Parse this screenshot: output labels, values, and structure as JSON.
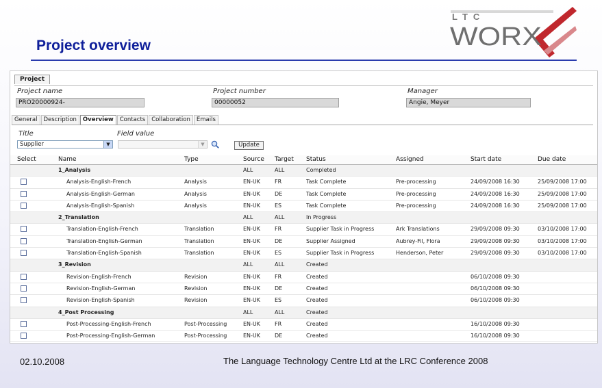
{
  "slide": {
    "title": "Project overview",
    "logo_small": "LTC",
    "logo_large": "WORX",
    "footer_date": "02.10.2008",
    "footer_text": "The Language Technology Centre Ltd at the LRC Conference 2008"
  },
  "colors": {
    "title": "#0f1f9a",
    "accent_x": "#c0272d",
    "logo_gray": "#6f6f6f"
  },
  "project": {
    "group_label": "Project",
    "name_label": "Project name",
    "name_value": "PRO20000924-",
    "number_label": "Project number",
    "number_value": "00000052",
    "manager_label": "Manager",
    "manager_value": "Angie, Meyer"
  },
  "tabs": [
    "General",
    "Description",
    "Overview",
    "Contacts",
    "Collaboration",
    "Emails"
  ],
  "active_tab": "Overview",
  "filter": {
    "title_label": "Title",
    "field_value_label": "Field value",
    "title_selected": "Supplier",
    "field_value": "",
    "search_icon": "search-icon",
    "update_label": "Update"
  },
  "grid": {
    "columns": [
      "Select",
      "Name",
      "Type",
      "Source",
      "Target",
      "Status",
      "Assigned",
      "Start date",
      "Due date"
    ],
    "rows": [
      {
        "group": true,
        "name": "1_Analysis",
        "type": "",
        "source": "ALL",
        "target": "ALL",
        "status": "Completed",
        "assigned": "",
        "start": "",
        "due": ""
      },
      {
        "group": false,
        "name": "Analysis-English-French",
        "type": "Analysis",
        "source": "EN-UK",
        "target": "FR",
        "status": "Task Complete",
        "assigned": "Pre-processing",
        "start": "24/09/2008 16:30",
        "due": "25/09/2008 17:00"
      },
      {
        "group": false,
        "name": "Analysis-English-German",
        "type": "Analysis",
        "source": "EN-UK",
        "target": "DE",
        "status": "Task Complete",
        "assigned": "Pre-processing",
        "start": "24/09/2008 16:30",
        "due": "25/09/2008 17:00"
      },
      {
        "group": false,
        "name": "Analysis-English-Spanish",
        "type": "Analysis",
        "source": "EN-UK",
        "target": "ES",
        "status": "Task Complete",
        "assigned": "Pre-processing",
        "start": "24/09/2008 16:30",
        "due": "25/09/2008 17:00"
      },
      {
        "group": true,
        "name": "2_Translation",
        "type": "",
        "source": "ALL",
        "target": "ALL",
        "status": "In Progress",
        "assigned": "",
        "start": "",
        "due": ""
      },
      {
        "group": false,
        "name": "Translation-English-French",
        "type": "Translation",
        "source": "EN-UK",
        "target": "FR",
        "status": "Supplier Task in Progress",
        "assigned": "Ark Translations",
        "start": "29/09/2008 09:30",
        "due": "03/10/2008 17:00"
      },
      {
        "group": false,
        "name": "Translation-English-German",
        "type": "Translation",
        "source": "EN-UK",
        "target": "DE",
        "status": "Supplier Assigned",
        "assigned": "Aubrey-Fil, Flora",
        "start": "29/09/2008 09:30",
        "due": "03/10/2008 17:00"
      },
      {
        "group": false,
        "name": "Translation-English-Spanish",
        "type": "Translation",
        "source": "EN-UK",
        "target": "ES",
        "status": "Supplier Task in Progress",
        "assigned": "Henderson, Peter",
        "start": "29/09/2008 09:30",
        "due": "03/10/2008 17:00"
      },
      {
        "group": true,
        "name": "3_Revision",
        "type": "",
        "source": "ALL",
        "target": "ALL",
        "status": "Created",
        "assigned": "",
        "start": "",
        "due": ""
      },
      {
        "group": false,
        "name": "Revision-English-French",
        "type": "Revision",
        "source": "EN-UK",
        "target": "FR",
        "status": "Created",
        "assigned": "",
        "start": "06/10/2008 09:30",
        "due": ""
      },
      {
        "group": false,
        "name": "Revision-English-German",
        "type": "Revision",
        "source": "EN-UK",
        "target": "DE",
        "status": "Created",
        "assigned": "",
        "start": "06/10/2008 09:30",
        "due": ""
      },
      {
        "group": false,
        "name": "Revision-English-Spanish",
        "type": "Revision",
        "source": "EN-UK",
        "target": "ES",
        "status": "Created",
        "assigned": "",
        "start": "06/10/2008 09:30",
        "due": ""
      },
      {
        "group": true,
        "name": "4_Post Processing",
        "type": "",
        "source": "ALL",
        "target": "ALL",
        "status": "Created",
        "assigned": "",
        "start": "",
        "due": ""
      },
      {
        "group": false,
        "name": "Post-Processing-English-French",
        "type": "Post-Processing",
        "source": "EN-UK",
        "target": "FR",
        "status": "Created",
        "assigned": "",
        "start": "16/10/2008 09:30",
        "due": ""
      },
      {
        "group": false,
        "name": "Post-Processing-English-German",
        "type": "Post-Processing",
        "source": "EN-UK",
        "target": "DE",
        "status": "Created",
        "assigned": "",
        "start": "16/10/2008 09:30",
        "due": ""
      },
      {
        "group": false,
        "name": "Post-Processing-English-Spanish",
        "type": "Post-Processing",
        "source": "EN-UK",
        "target": "ES",
        "status": "Created",
        "assigned": "",
        "start": "16/10/2008 09:30",
        "due": ""
      }
    ]
  }
}
